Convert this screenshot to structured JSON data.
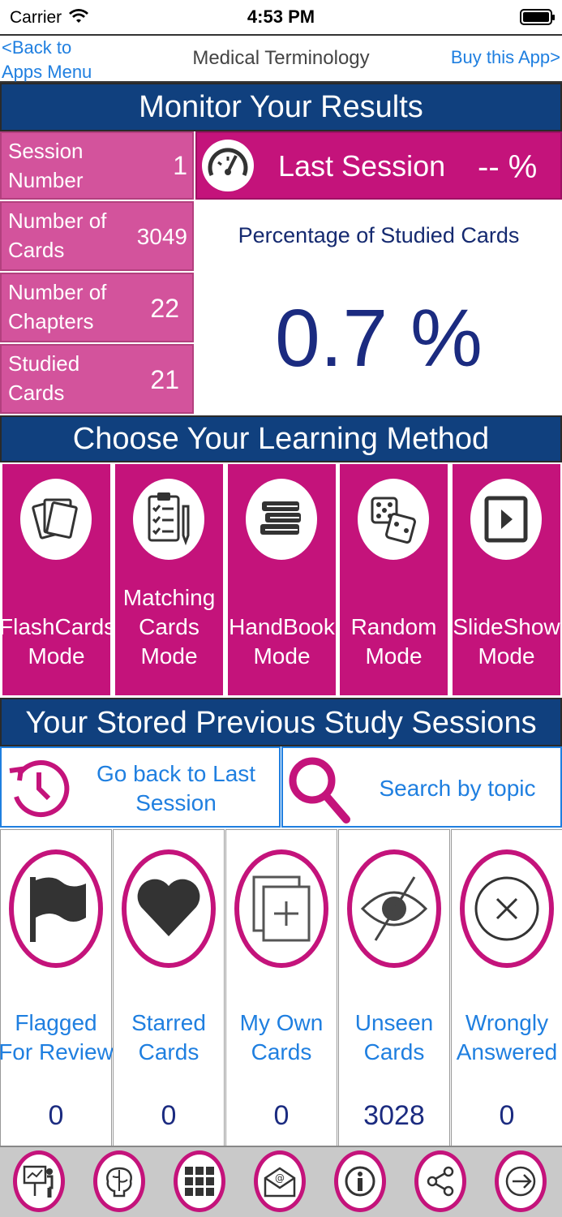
{
  "status": {
    "carrier": "Carrier",
    "time": "4:53 PM"
  },
  "nav": {
    "back": "<Back to Apps Menu",
    "title": "Medical Terminology",
    "buy": "Buy this App>"
  },
  "monitor": {
    "header": "Monitor Your Results",
    "stats": [
      {
        "label": "Session Number",
        "value": "1"
      },
      {
        "label": "Number of Cards",
        "value": "3049"
      },
      {
        "label": "Number of Chapters",
        "value": "22"
      },
      {
        "label": "Studied Cards",
        "value": "21"
      }
    ],
    "last_session_label": "Last Session",
    "last_session_value": "-- %",
    "percentage_label": "Percentage of Studied Cards",
    "percentage_value": "0.7 %"
  },
  "learning": {
    "header": "Choose Your Learning Method",
    "modes": [
      {
        "label": "FlashCards Mode",
        "icon": "flashcards-icon"
      },
      {
        "label": "Matching Cards Mode",
        "icon": "clipboard-checklist-icon"
      },
      {
        "label": "HandBook Mode",
        "icon": "books-icon"
      },
      {
        "label": "Random Mode",
        "icon": "dice-icon"
      },
      {
        "label": "SlideShow Mode",
        "icon": "play-icon"
      }
    ]
  },
  "sessions": {
    "header": "Your Stored Previous Study Sessions",
    "go_back": "Go back to Last Session",
    "search": "Search by topic",
    "cards": [
      {
        "label": "Flagged For Review",
        "count": "0",
        "icon": "flag-icon"
      },
      {
        "label": "Starred Cards",
        "count": "0",
        "icon": "heart-icon"
      },
      {
        "label": "My Own Cards",
        "count": "0",
        "icon": "add-card-icon"
      },
      {
        "label": "Unseen Cards",
        "count": "3028",
        "icon": "eye-slash-icon"
      },
      {
        "label": "Wrongly Answered",
        "count": "0",
        "icon": "x-circle-icon"
      }
    ]
  },
  "colors": {
    "navy": "#10407e",
    "magenta": "#c4137b",
    "pink": "#d3539c",
    "link": "#1f7fe0"
  }
}
